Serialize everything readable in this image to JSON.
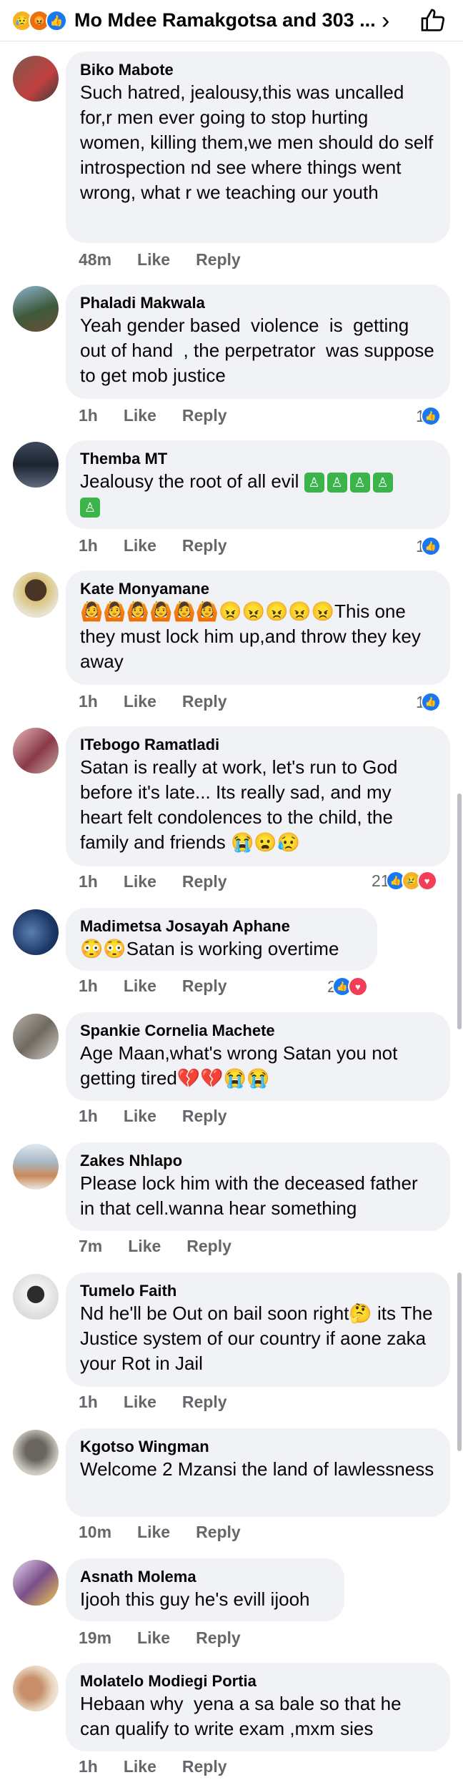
{
  "header": {
    "title": "Mo Mdee Ramakgotsa and 303 ...",
    "reactions": [
      "sad",
      "angry",
      "like"
    ]
  },
  "comments": [
    {
      "author": "Biko Mabote",
      "text": "Such hatred, jealousy,this was uncalled for,r men ever going to stop hurting women, killing them,we men should do self introspection nd see where things went wrong, what r we teaching our youth",
      "time": "48m",
      "like": "Like",
      "reply": "Reply",
      "count": ""
    },
    {
      "author": "Phaladi Makwala",
      "text": "Yeah gender based  violence  is  getting out of hand  , the perpetrator  was suppose to get mob justice",
      "time": "1h",
      "like": "Like",
      "reply": "Reply",
      "count": "1"
    },
    {
      "author": "Themba MT",
      "text": "Jealousy the root of all evil",
      "time": "1h",
      "like": "Like",
      "reply": "Reply",
      "count": "1"
    },
    {
      "author": "Kate Monyamane",
      "text": "🙆🙆🙆🙆🙆🙆😠😠😠😠😠This one they must lock him up,and throw they key away",
      "time": "1h",
      "like": "Like",
      "reply": "Reply",
      "count": "1"
    },
    {
      "author": "ITebogo Ramatladi",
      "text": "Satan is really at work, let's run to God before it's late... Its really sad, and my heart felt condolences to the child, the family and friends 😭😦😥",
      "time": "1h",
      "like": "Like",
      "reply": "Reply",
      "count": "21"
    },
    {
      "author": "Madimetsa Josayah Aphane",
      "text": "😳😳Satan is working overtime",
      "time": "1h",
      "like": "Like",
      "reply": "Reply",
      "count": "2"
    },
    {
      "author": "Spankie Cornelia Machete",
      "text": "Age Maan,what's wrong Satan you not getting tired💔💔😭😭",
      "time": "1h",
      "like": "Like",
      "reply": "Reply",
      "count": ""
    },
    {
      "author": "Zakes Nhlapo",
      "text": "Please lock him with the deceased father in that cell.wanna hear something",
      "time": "7m",
      "like": "Like",
      "reply": "Reply",
      "count": ""
    },
    {
      "author": "Tumelo Faith",
      "text": "Nd he'll be Out on bail soon right🤔 its The Justice system of our country if aone zaka your Rot in Jail",
      "time": "1h",
      "like": "Like",
      "reply": "Reply",
      "count": ""
    },
    {
      "author": "Kgotso Wingman",
      "text": "Welcome 2 Mzansi the land of lawlessness",
      "time": "10m",
      "like": "Like",
      "reply": "Reply",
      "count": ""
    },
    {
      "author": "Asnath Molema",
      "text": "Ijooh this guy he's evill ijooh",
      "time": "19m",
      "like": "Like",
      "reply": "Reply",
      "count": ""
    },
    {
      "author": "Molatelo Modiegi Portia",
      "text": "Hebaan why  yena a sa bale so that he can qualify to write exam ,mxm sies",
      "time": "1h",
      "like": "Like",
      "reply": "Reply",
      "count": ""
    }
  ]
}
